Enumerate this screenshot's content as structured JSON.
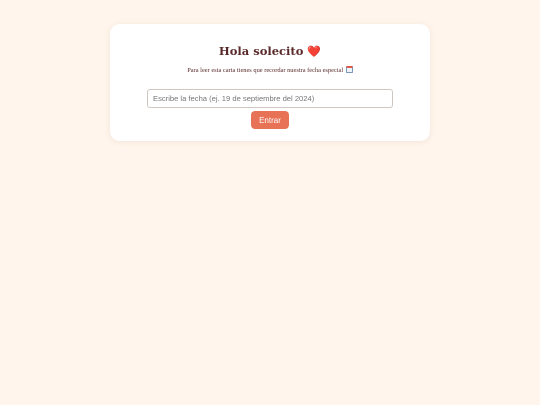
{
  "page": {
    "background_color": "#fff5ec"
  },
  "card": {
    "title": "Hola solecito",
    "title_emoji": "❤️",
    "subtitle": "Para leer esta carta tienes que recordar nuestra fecha especial",
    "subtitle_icon": "calendar-icon"
  },
  "form": {
    "date_placeholder": "Escribe la fecha (ej. 19 de septiembre del 2024)",
    "date_value": "",
    "submit_label": "Entrar"
  },
  "colors": {
    "title_text": "#5a2a2a",
    "button_background": "#e87256",
    "button_text": "#ffffff",
    "heart": "#e0393b"
  }
}
